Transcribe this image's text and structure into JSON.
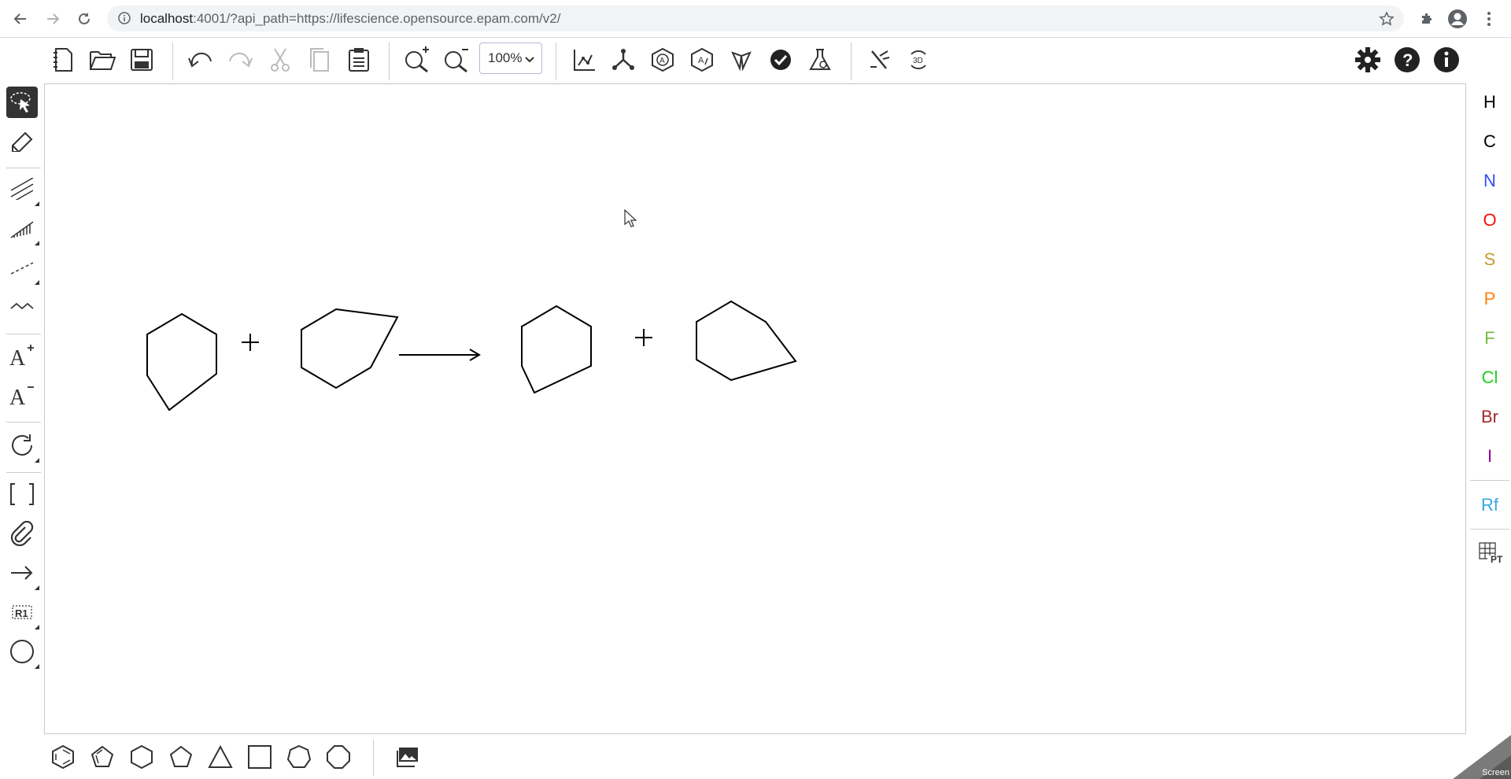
{
  "browser": {
    "url_host": "localhost",
    "url_rest": ":4001/?api_path=https://lifescience.opensource.epam.com/v2/",
    "icons": [
      "back-arrow-icon",
      "forward-arrow-icon",
      "reload-icon",
      "info-icon",
      "star-icon",
      "extensions-icon",
      "profile-icon",
      "kebab-menu-icon"
    ]
  },
  "toolbar": {
    "zoom_value": "100%",
    "zoom_options": [
      "100%"
    ],
    "buttons": [
      "new-document",
      "open-file",
      "save-file",
      "undo",
      "redo",
      "cut",
      "copy",
      "paste",
      "zoom-in",
      "zoom-out",
      "layout",
      "clean-up",
      "aromatize",
      "dearomatize",
      "calculate-cip",
      "check-structure",
      "analyse",
      "recognize",
      "3d-viewer",
      "settings",
      "help",
      "about"
    ]
  },
  "left_tools": [
    "select",
    "erase",
    "bond-single",
    "bond-hash",
    "bond-dashed",
    "bond-any",
    "charge-plus",
    "charge-minus",
    "rotate",
    "s-group-brackets",
    "attachment",
    "reaction-arrow",
    "r-group",
    "shape-ellipse"
  ],
  "elements": {
    "H": {
      "label": "H",
      "color": "#000000"
    },
    "C": {
      "label": "C",
      "color": "#000000"
    },
    "N": {
      "label": "N",
      "color": "#304ff7"
    },
    "O": {
      "label": "O",
      "color": "#ff0d0d"
    },
    "S": {
      "label": "S",
      "color": "#c99a2e"
    },
    "P": {
      "label": "P",
      "color": "#ff8000"
    },
    "F": {
      "label": "F",
      "color": "#78bc42"
    },
    "Cl": {
      "label": "Cl",
      "color": "#1fd01f"
    },
    "Br": {
      "label": "Br",
      "color": "#a62929"
    },
    "I": {
      "label": "I",
      "color": "#940094"
    },
    "Rf": {
      "label": "Rf",
      "color": "#3aa7e2"
    },
    "PT": {
      "label": "PT",
      "color": "#333333"
    }
  },
  "templates": [
    "benzene",
    "cyclopentadiene",
    "cyclohexane",
    "cyclopentane",
    "cyclopropane",
    "cyclobutane",
    "cycloheptane",
    "cyclooctane"
  ],
  "canvas": {
    "reaction": [
      "reactant-1",
      "plus",
      "reactant-2",
      "arrow",
      "product-1",
      "plus",
      "product-2"
    ]
  },
  "badge": {
    "text": "Screen"
  }
}
